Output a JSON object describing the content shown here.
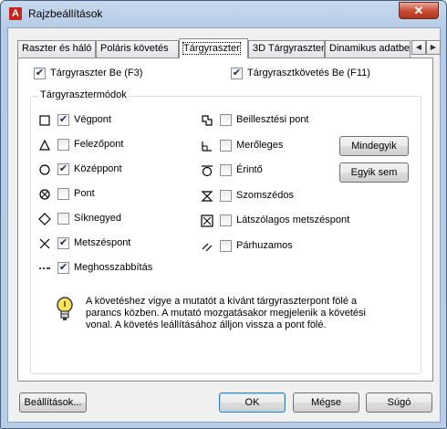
{
  "window": {
    "title": "Rajzbeállítások",
    "close_glyph": "✕",
    "app_icon_letter": "A"
  },
  "tabs": [
    {
      "label": "Raszter és háló",
      "active": false
    },
    {
      "label": "Poláris követés",
      "active": false
    },
    {
      "label": "Tárgyraszter",
      "active": true
    },
    {
      "label": "3D Tárgyraszter",
      "active": false
    },
    {
      "label": "Dinamikus adatbevit",
      "active": false
    }
  ],
  "tab_scroll": {
    "left": "◀",
    "right": "▶"
  },
  "top_checks": {
    "osnap_on": {
      "label": "Tárgyraszter Be (F3)",
      "checked": true
    },
    "tracking_on": {
      "label": "Tárgyrasztkövetés Be (F11)",
      "checked": true
    }
  },
  "modes_group": {
    "title": "Tárgyrasztermódok",
    "left": [
      {
        "label": "Végpont",
        "checked": true,
        "symbol": "square-icon"
      },
      {
        "label": "Felezőpont",
        "checked": false,
        "symbol": "triangle-icon"
      },
      {
        "label": "Középpont",
        "checked": true,
        "symbol": "circle-icon"
      },
      {
        "label": "Pont",
        "checked": false,
        "symbol": "node-icon"
      },
      {
        "label": "Síknegyed",
        "checked": false,
        "symbol": "diamond-icon"
      },
      {
        "label": "Metszéspont",
        "checked": true,
        "symbol": "x-icon"
      },
      {
        "label": "Meghosszabbítás",
        "checked": true,
        "symbol": "extension-icon"
      }
    ],
    "right": [
      {
        "label": "Beillesztési pont",
        "checked": false,
        "symbol": "insertion-icon"
      },
      {
        "label": "Merőleges",
        "checked": false,
        "symbol": "perpendicular-icon"
      },
      {
        "label": "Érintő",
        "checked": false,
        "symbol": "tangent-icon"
      },
      {
        "label": "Szomszédos",
        "checked": false,
        "symbol": "nearest-icon"
      },
      {
        "label": "Látszólagos metszéspont",
        "checked": false,
        "symbol": "apparent-intersection-icon"
      },
      {
        "label": "Párhuzamos",
        "checked": false,
        "symbol": "parallel-icon"
      }
    ],
    "select_all": "Mindegyik",
    "clear_all": "Egyik sem"
  },
  "info": {
    "text": "A követéshez vigye a mutatót a kívánt tárgyraszterpont fölé a parancs közben. A mutató mozgatásakor megjelenik a követési vonal. A követés leállításához álljon vissza a pont fölé."
  },
  "footer": {
    "settings": "Beállítások...",
    "ok": "OK",
    "cancel": "Mégse",
    "help": "Súgó"
  },
  "colors": {
    "check": "#1f2c4e",
    "accent": "#3c7fb1",
    "close": "#c75239"
  }
}
